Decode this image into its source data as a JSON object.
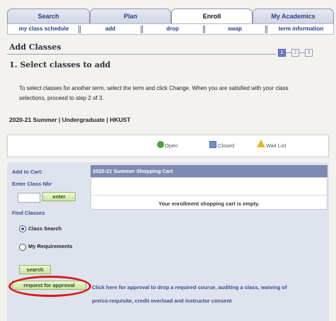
{
  "tabs": [
    "Search",
    "Plan",
    "Enroll",
    "My Academics"
  ],
  "subnav": [
    "my class schedule",
    "add",
    "drop",
    "swap",
    "term information"
  ],
  "page_title": "Add Classes",
  "steps": [
    "1",
    "2",
    "3"
  ],
  "section_title": "1.  Select classes to add",
  "instructions": "To select classes for another term, select the term and click Change.  When you are satisfied with your class selections, proceed to step 2 of 3.",
  "term": "2020-21 Summer | Undergraduate | HKUST",
  "legend": {
    "open": "Open",
    "closed": "Closed",
    "wait": "Wait List"
  },
  "add_to_cart": {
    "title": "Add to Cart:",
    "enter_label": "Enter Class Nbr",
    "enter_button": "enter",
    "find_label": "Find Classes",
    "class_search": "Class Search",
    "my_requirements": "My Requirements",
    "search_button": "search",
    "approval_button": "request for approval"
  },
  "cart": {
    "title": "2020-21 Summer Shopping Cart",
    "empty_text": "Your enrollment shopping cart is empty."
  },
  "approval_text": "Click here for approval to drop a required course, auditing a class, waiving of pre/co-requisite, credit overload and instructor consent"
}
